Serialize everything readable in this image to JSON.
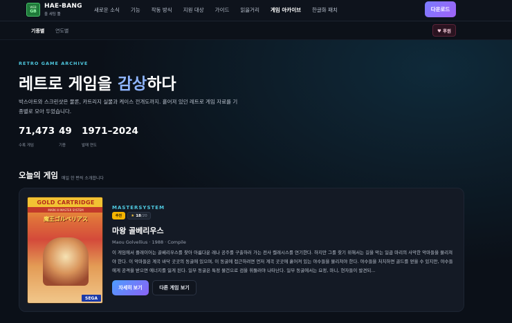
{
  "header": {
    "logo_line1": "WEB",
    "logo_line2": "GB",
    "brand_name": "HAE-BANG",
    "brand_sub": "올 세팅 툴",
    "nav": [
      "새로운 소식",
      "기능",
      "작동 방식",
      "지원 대상",
      "가이드",
      "읽을거리",
      "게임 아카이브",
      "한글화 패치"
    ],
    "active_nav": "게임 아카이브",
    "download_label": "다운로드"
  },
  "subnav": {
    "tabs": [
      "기종별",
      "연도별"
    ],
    "sponsor_label": "♥ 후원"
  },
  "hero": {
    "eyebrow": "RETRO GAME ARCHIVE",
    "headline_pre": "레트로 게임을 ",
    "headline_accent": "감상",
    "headline_post": "하다",
    "description": "박스아트와 스크린샷은 물론, 카트리지 실물과 케이스 전개도까지. 흩어져 있던 레트로 게임 자료를 기종별로 모아 두었습니다.",
    "stats": [
      {
        "value": "71,473",
        "label": "수록 게임"
      },
      {
        "value": "49",
        "label": "기종"
      },
      {
        "value": "1971–2024",
        "label": "발매 연도"
      }
    ]
  },
  "today": {
    "title": "오늘의 게임",
    "subtitle": "매일 한 편씩 소개합니다",
    "cover": {
      "top": "GOLD CARTRIDGE",
      "band": "MARK III  MASTER SYSTEM",
      "title": "魔王ゴルベリアス",
      "sega": "SEGA"
    },
    "platform": "MASTERSYSTEM",
    "badge": "추천",
    "score": "18",
    "score_of": "/20",
    "game_title": "마왕 골베리우스",
    "meta": "Maou Golvellius · 1988 · Compile",
    "desc": "이 게임에서 플레이어는 골베리우스를 찾아 아름다운 레나 공주를 구출하러 가는 전사 켈레시스를 연기한다. 하지만 그를 찾기 위해서는 길을 막는 일곱 마리의 사악한 악마들을 물리쳐야 한다. 이 악마들은 계곡 바닥 곳곳의 동굴에 있으며, 이 동굴에 접근하려면 먼저 계곡 곳곳에 흩어져 있는 야수들을 물리쳐야 한다. 야수들을 처치하면 골드를 얻을 수 있지만, 야수들에게 공격을 받으면 에너지를 잃게 된다. 일부 동굴은 특정 물건으로 검을 휘둘러야 나타난다. 일부 동굴에서는 요정, 마니, 현자들이 발견되...",
    "detail_label": "자세히 보기",
    "other_label": "다른 게임 보기"
  }
}
